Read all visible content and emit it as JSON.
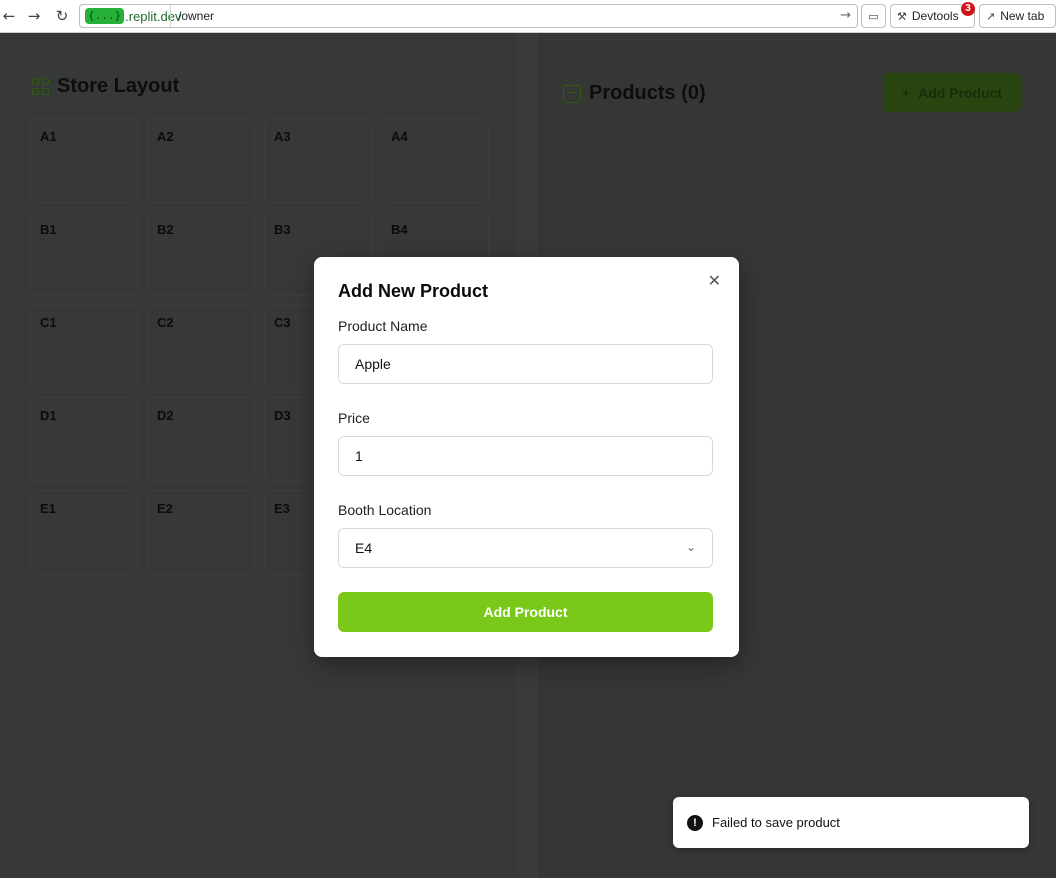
{
  "browser": {
    "back_icon": "back-arrow-icon",
    "forward_icon": "forward-arrow-icon",
    "reload_icon": "reload-icon",
    "domain_badge": "{...}",
    "domain": ".replit.dev",
    "path": "/owner",
    "devtools_label": "Devtools",
    "devtools_badge": "3",
    "new_tab_label": "New tab"
  },
  "store": {
    "title": "Store Layout",
    "booths": [
      "A1",
      "A2",
      "A3",
      "A4",
      "B1",
      "B2",
      "B3",
      "B4",
      "C1",
      "C2",
      "C3",
      "",
      "D1",
      "D2",
      "D3",
      "",
      "E1",
      "E2",
      "E3",
      ""
    ]
  },
  "products": {
    "title": "Products (0)",
    "add_button": "Add Product"
  },
  "modal": {
    "title": "Add New Product",
    "name_label": "Product Name",
    "name_value": "Apple",
    "price_label": "Price",
    "price_value": "1",
    "booth_label": "Booth Location",
    "booth_value": "E4",
    "submit_label": "Add Product"
  },
  "toast": {
    "message": "Failed to save product"
  },
  "colors": {
    "accent": "#7ac81a",
    "overlay": "#353735",
    "error_badge": "#d0141c"
  }
}
